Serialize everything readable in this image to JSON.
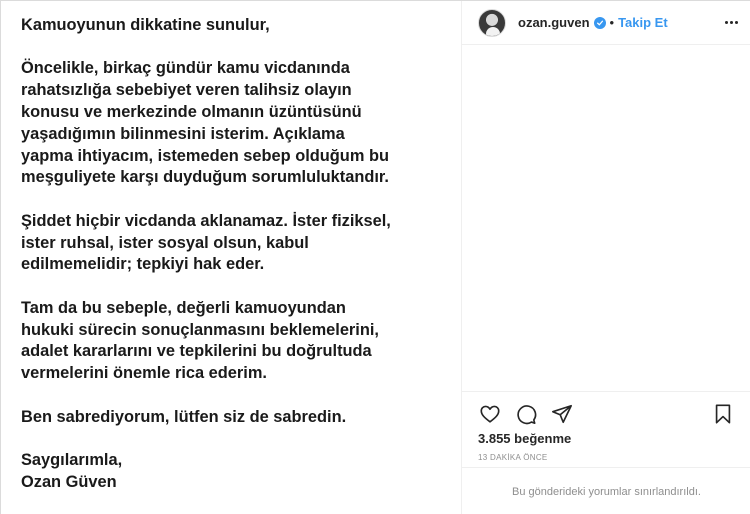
{
  "post": {
    "statement": [
      "Kamuoyunun dikkatine sunulur,",
      "Öncelikle, birkaç gündür kamu vicdanında\nrahatsızlığa sebebiyet veren talihsiz olayın\nkonusu ve merkezinde olmanın üzüntüsünü\nyaşadığımın bilinmesini isterim. Açıklama\nyapma ihtiyacım, istemeden sebep olduğum bu\nmeşguliyete karşı duyduğum sorumluluktandır.",
      "Şiddet hiçbir vicdanda aklanamaz. İster fiziksel,\nister ruhsal, ister sosyal olsun, kabul\nedilmemelidir; tepkiyi hak eder.",
      "Tam da bu sebeple, değerli kamuoyundan\nhukuki sürecin sonuçlanmasını beklemelerini,\nadalet kararlarını ve tepkilerini bu doğrultuda\nvermelerini önemle rica ederim.",
      "Ben sabrediyorum, lütfen siz de sabredin.",
      "Saygılarımla,\nOzan Güven"
    ]
  },
  "header": {
    "username": "ozan.guven",
    "separator": "•",
    "follow_label": "Takip Et",
    "verified_icon": "verified-badge-icon",
    "more_icon": "more-options-icon"
  },
  "actions": {
    "like_icon": "heart-icon",
    "comment_icon": "comment-icon",
    "share_icon": "share-icon",
    "save_icon": "bookmark-icon"
  },
  "stats": {
    "likes_count": "3.855",
    "likes_label": "beğenme",
    "timestamp": "13 DAKİKA ÖNCE"
  },
  "comments": {
    "restricted_note": "Bu gönderideki yorumlar sınırlandırıldı."
  },
  "colors": {
    "accent": "#3897f0",
    "text": "#262626",
    "muted": "#8e8e8e",
    "border": "#efefef"
  }
}
